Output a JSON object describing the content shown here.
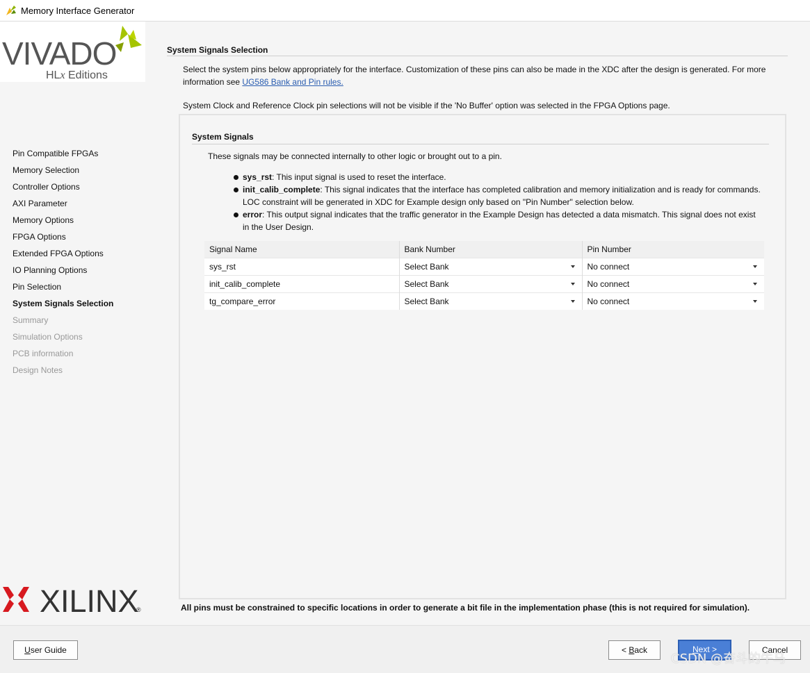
{
  "window": {
    "title": "Memory Interface Generator"
  },
  "branding": {
    "vivado_word": "VIVADO",
    "hlx_prefix": "HL",
    "hlx_italic": "x",
    "hlx_suffix": " Editions",
    "xilinx_word": "XILINX",
    "registered": "®",
    "vivado_green": "#a5c400",
    "xilinx_red": "#d7191f"
  },
  "sidebar": {
    "items": [
      {
        "label": "Pin Compatible FPGAs",
        "state": "normal"
      },
      {
        "label": "Memory Selection",
        "state": "normal"
      },
      {
        "label": "Controller Options",
        "state": "normal"
      },
      {
        "label": "AXI Parameter",
        "state": "normal"
      },
      {
        "label": "Memory Options",
        "state": "normal"
      },
      {
        "label": "FPGA Options",
        "state": "normal"
      },
      {
        "label": "Extended FPGA Options",
        "state": "normal"
      },
      {
        "label": "IO Planning Options",
        "state": "normal"
      },
      {
        "label": "Pin Selection",
        "state": "normal"
      },
      {
        "label": "System Signals Selection",
        "state": "active"
      },
      {
        "label": "Summary",
        "state": "disabled"
      },
      {
        "label": "Simulation Options",
        "state": "disabled"
      },
      {
        "label": "PCB information",
        "state": "disabled"
      },
      {
        "label": "Design Notes",
        "state": "disabled"
      }
    ]
  },
  "main": {
    "section_title": "System Signals Selection",
    "intro_text": "Select the system pins below appropriately for the interface. Customization of these pins can also be made in the XDC after the design is generated. For more information see ",
    "intro_link": "UG586 Bank and Pin rules.",
    "note": "System Clock and Reference Clock pin selections will not be visible if the 'No Buffer' option was selected in the FPGA Options page.",
    "panel": {
      "title": "System Signals",
      "intro": "These signals may be connected internally to other logic or brought out to a pin.",
      "bullets": [
        {
          "term": "sys_rst",
          "text": ": This input signal is used to reset the interface."
        },
        {
          "term": "init_calib_complete",
          "text": ": This signal indicates that the interface has completed calibration and memory initialization and is ready for commands. LOC constraint will be generated in XDC for Example design only based on \"Pin Number\" selection below."
        },
        {
          "term": "error",
          "text": ": This output signal indicates that the traffic generator in the Example Design has detected a data mismatch. This signal does not exist in the User Design."
        }
      ],
      "table": {
        "headers": [
          "Signal Name",
          "Bank Number",
          "Pin Number"
        ],
        "rows": [
          {
            "signal": "sys_rst",
            "bank": "Select Bank",
            "pin": "No connect"
          },
          {
            "signal": "init_calib_complete",
            "bank": "Select Bank",
            "pin": "No connect"
          },
          {
            "signal": "tg_compare_error",
            "bank": "Select Bank",
            "pin": "No connect"
          }
        ]
      }
    },
    "footnote": "All pins must be constrained to specific locations in order to generate a bit file in the implementation phase (this is not required for simulation)."
  },
  "buttons": {
    "user_guide_u": "U",
    "user_guide_rest": "ser Guide",
    "back_prefix": "< ",
    "back_u": "B",
    "back_rest": "ack",
    "next_u": "N",
    "next_rest": "ext >",
    "cancel": "Cancel"
  },
  "watermark": "CSDN @奋斗的牛马"
}
